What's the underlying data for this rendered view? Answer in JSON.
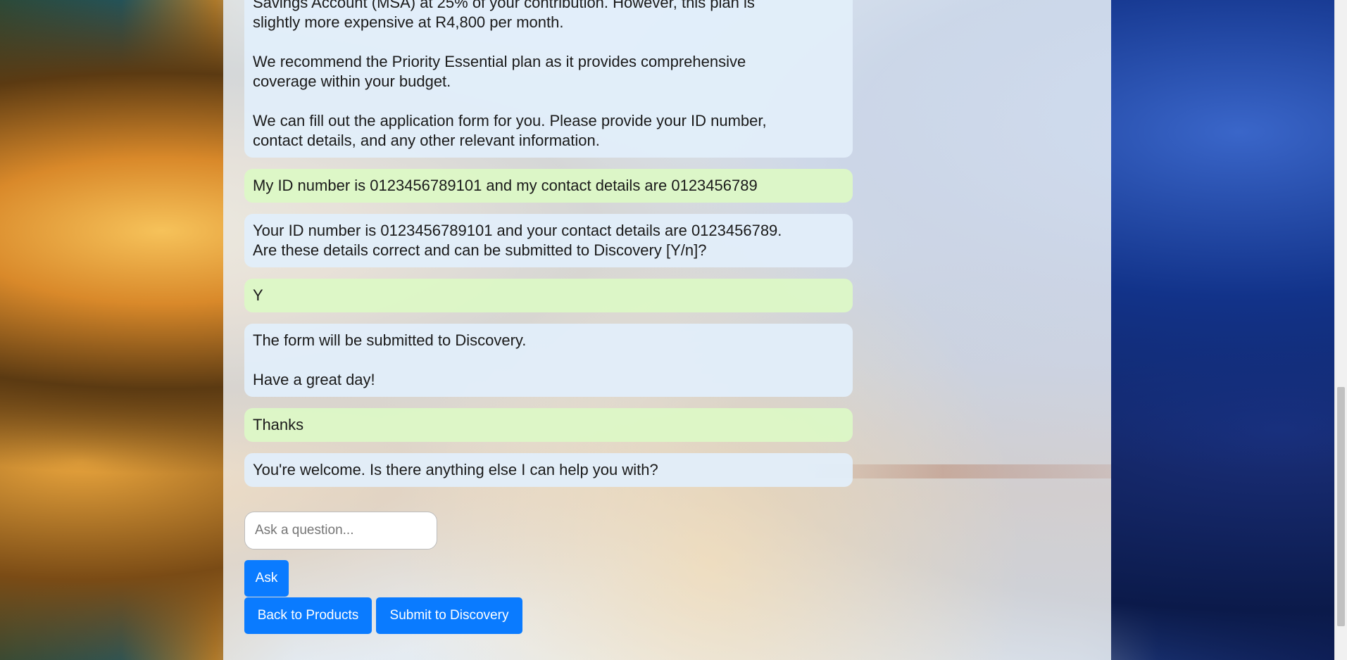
{
  "messages": [
    {
      "role": "bot",
      "text": "Savings Account (MSA) at 25% of your contribution. However, this plan is\nslightly more expensive at R4,800 per month.\n\nWe recommend the Priority Essential plan as it provides comprehensive\ncoverage within your budget.\n\nWe can fill out the application form for you. Please provide your ID number,\ncontact details, and any other relevant information."
    },
    {
      "role": "user",
      "text": "My ID number is 0123456789101 and my contact details are 0123456789"
    },
    {
      "role": "bot",
      "text": "Your ID number is 0123456789101 and your contact details are 0123456789.\nAre these details correct and can be submitted to Discovery [Y/n]?"
    },
    {
      "role": "user",
      "text": "Y"
    },
    {
      "role": "bot",
      "text": "The form will be submitted to Discovery.\n\nHave a great day!"
    },
    {
      "role": "user",
      "text": "Thanks"
    },
    {
      "role": "bot",
      "text": "You're welcome. Is there anything else I can help you with?"
    }
  ],
  "input": {
    "placeholder": "Ask a question...",
    "value": ""
  },
  "buttons": {
    "ask": "Ask",
    "back": "Back to Products",
    "submit": "Submit to Discovery"
  },
  "colors": {
    "bot_bubble": "#e2eefa",
    "user_bubble": "#dcf8c6",
    "button": "#0a7bff"
  }
}
